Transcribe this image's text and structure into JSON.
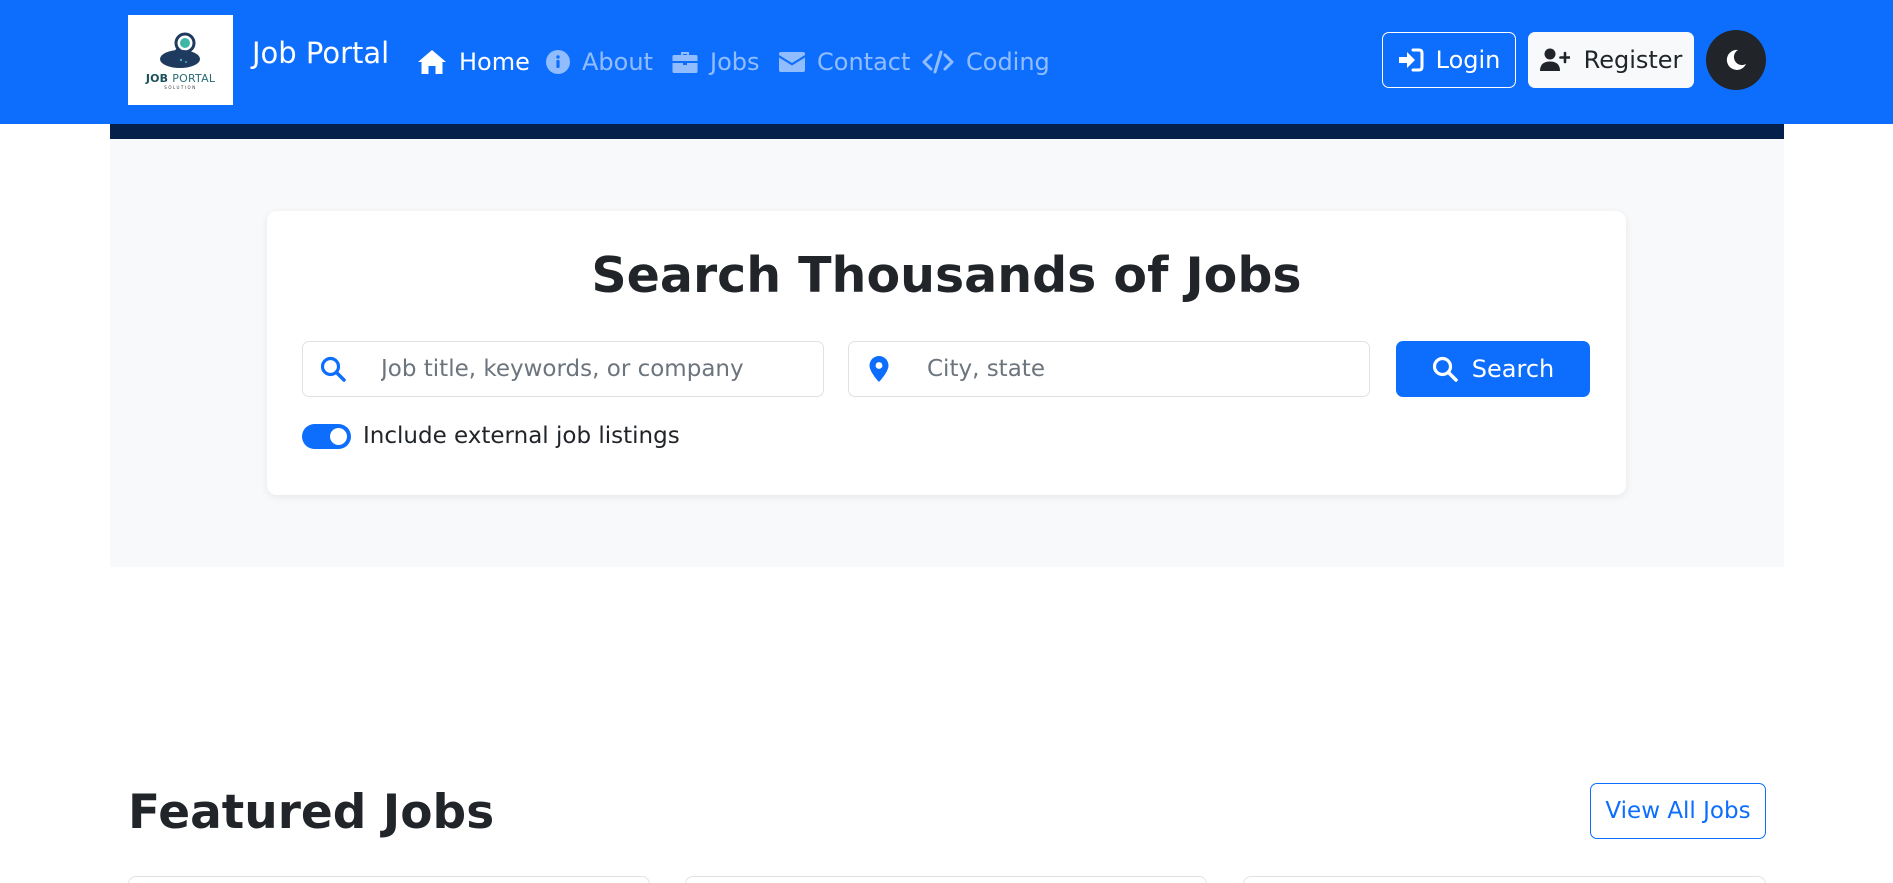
{
  "navbar": {
    "logo": {
      "text_bold": "JOB",
      "text_thin": "PORTAL",
      "subtext": "SOLUTION"
    },
    "brand": "Job Portal",
    "links": [
      {
        "label": "Home",
        "icon": "home-icon",
        "active": true
      },
      {
        "label": "About",
        "icon": "info-circle-icon",
        "active": false
      },
      {
        "label": "Jobs",
        "icon": "briefcase-icon",
        "active": false
      },
      {
        "label": "Contact",
        "icon": "envelope-icon",
        "active": false
      },
      {
        "label": "Coding",
        "icon": "code-icon",
        "active": false
      }
    ],
    "login_label": "Login",
    "register_label": "Register",
    "theme_toggle_icon": "moon-icon"
  },
  "search": {
    "title": "Search Thousands of Jobs",
    "keyword_placeholder": "Job title, keywords, or company",
    "keyword_value": "",
    "location_placeholder": "City, state",
    "location_value": "",
    "button_label": "Search",
    "external_toggle_label": "Include external job listings",
    "external_toggle_on": true
  },
  "featured": {
    "title": "Featured Jobs",
    "view_all_label": "View All Jobs"
  },
  "colors": {
    "primary": "#0d6efd",
    "dark_strip": "#05204a",
    "hero_bg": "#f8f9fa",
    "text": "#212529"
  }
}
